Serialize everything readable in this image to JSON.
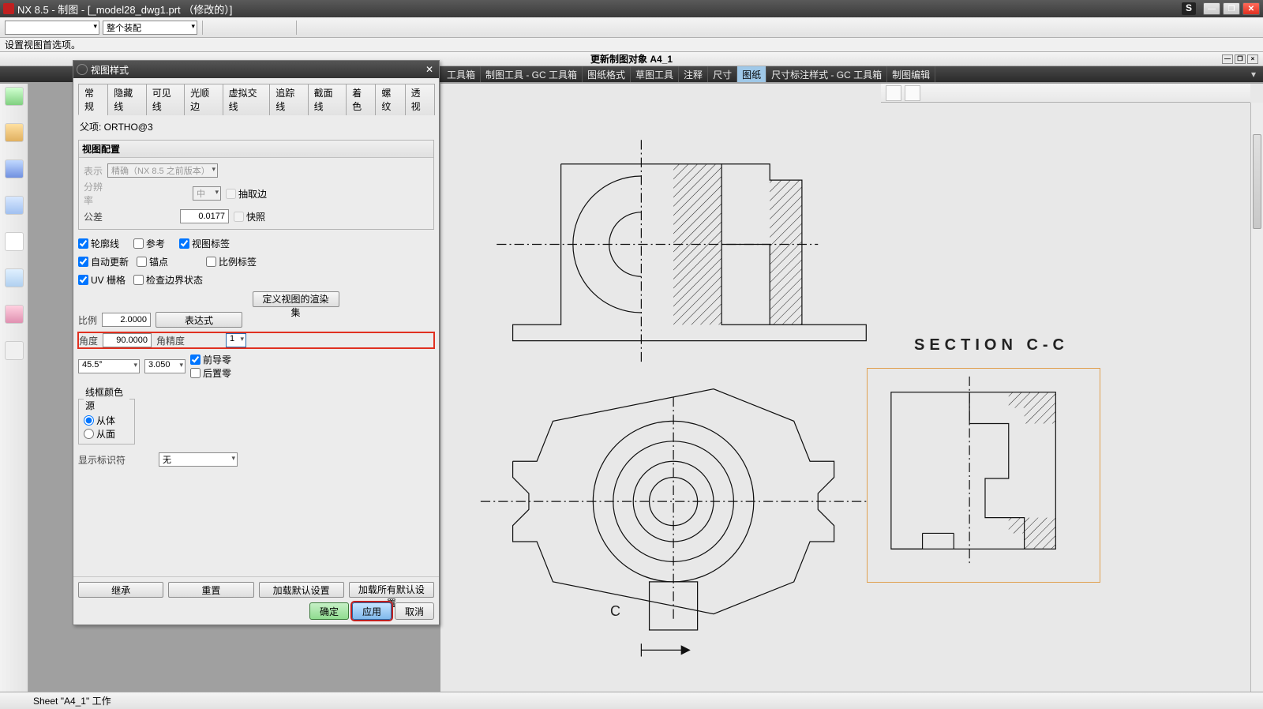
{
  "title": "NX 8.5 - 制图 - [_model28_dwg1.prt （修改的）]",
  "s_badge": "S",
  "assembly_combo": "整个装配",
  "hint": "设置视图首选项。",
  "subtitle": "更新制图对象 A4_1",
  "ribbon_tabs": [
    "工具箱",
    "制图工具 - GC 工具箱",
    "图纸格式",
    "草图工具",
    "注释",
    "尺寸",
    "图纸",
    "尺寸标注样式 - GC 工具箱",
    "制图编辑"
  ],
  "ribbon_active_index": 6,
  "dialog": {
    "title": "视图样式",
    "tabs": [
      "常规",
      "隐藏线",
      "可见线",
      "光顺边",
      "虚拟交线",
      "追踪线",
      "截面线",
      "着色",
      "螺纹",
      "透视"
    ],
    "active_tab_index": 0,
    "parent": "父项: ORTHO@3",
    "view_config_title": "视图配置",
    "display_label": "表示",
    "display_value": "精确（NX 8.5 之前版本）",
    "resolution_label": "分辨率",
    "resolution_value": "中",
    "tolerance_label": "公差",
    "tolerance_value": "0.0177",
    "extract_edge": "抽取边",
    "snapshot": "快照",
    "chk_contour": "轮廓线",
    "chk_reference": "参考",
    "chk_viewlabel": "视图标签",
    "chk_autoupdate": "自动更新",
    "chk_anchor": "锚点",
    "chk_scalelabel": "比例标签",
    "chk_uvgrid": "UV 栅格",
    "chk_checkboundary": "检查边界状态",
    "btn_renderset": "定义视图的渲染集",
    "scale_label": "比例",
    "scale_value": "2.0000",
    "btn_expression": "表达式",
    "angle_label": "角度",
    "angle_value": "90.0000",
    "angle_precision_label": "角精度",
    "angle_precision_value": "1",
    "combo_455": "45.5°",
    "combo_305": "3.050",
    "chk_leadzero": "前导零",
    "chk_trailzero": "后置零",
    "frame_color_title": "线框颜色源",
    "radio_frombody": "从体",
    "radio_fromface": "从面",
    "marker_label": "显示标识符",
    "marker_value": "无",
    "btn_inherit": "继承",
    "btn_reset": "重置",
    "btn_loaddefault": "加载默认设置",
    "btn_loadalldefault": "加载所有默认设置",
    "btn_ok": "确定",
    "btn_apply": "应用",
    "btn_cancel": "取消"
  },
  "section_label": "SECTION C-C",
  "c_label": "C",
  "status_text": "Sheet \"A4_1\" 工作"
}
